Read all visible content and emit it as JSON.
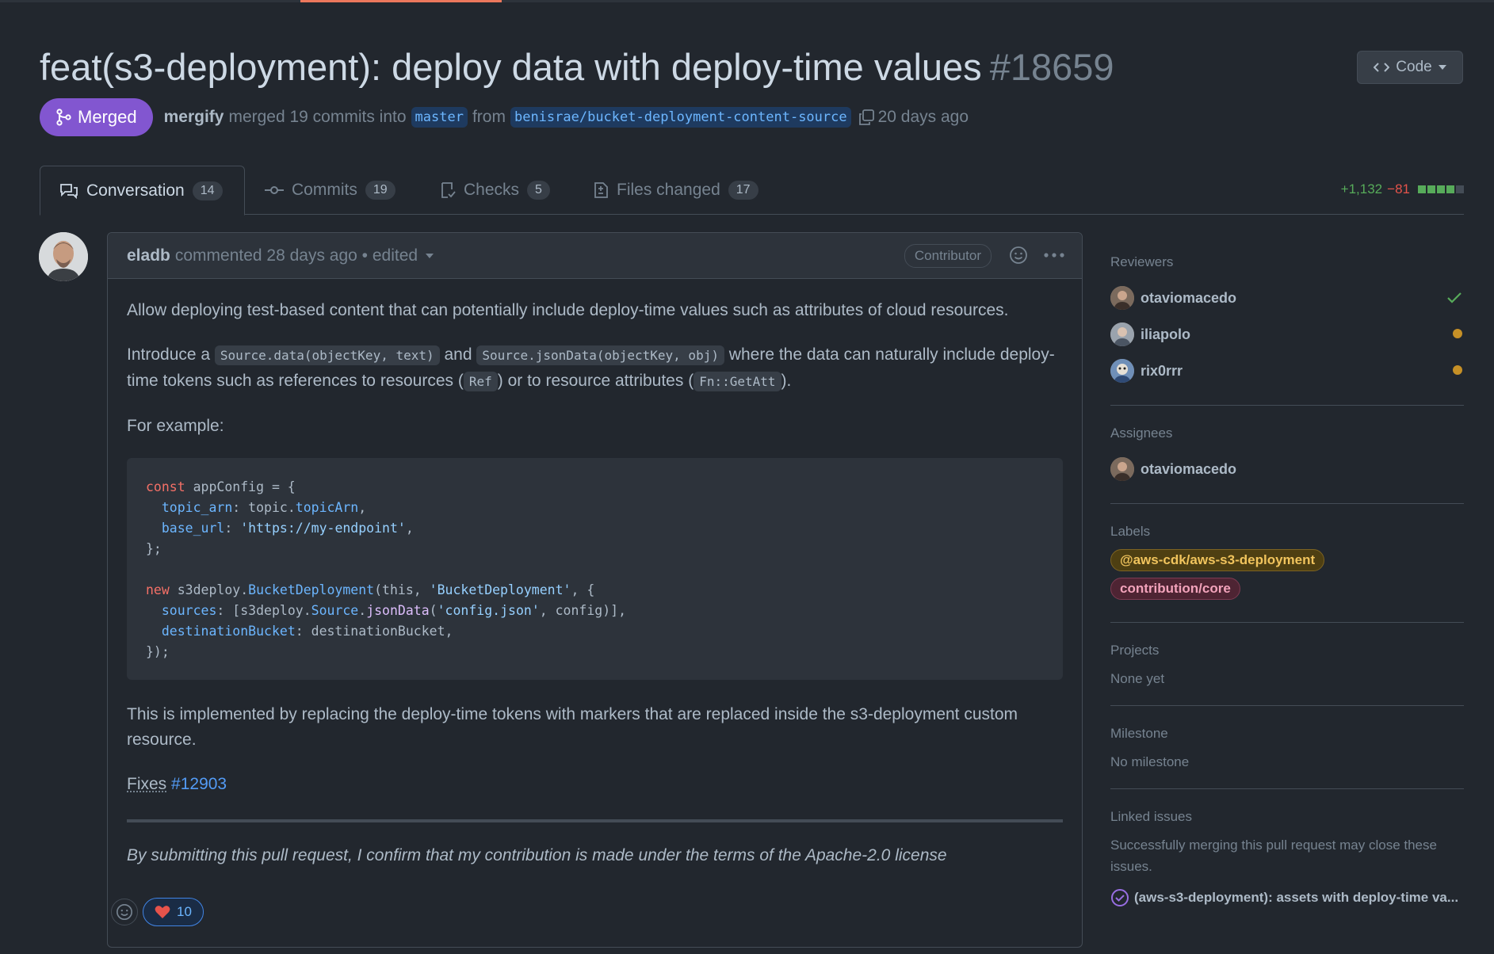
{
  "header": {
    "title": "feat(s3-deployment): deploy data with deploy-time values",
    "number": "#18659",
    "code_button": "Code"
  },
  "meta": {
    "status": "Merged",
    "author": "mergify",
    "action": "merged 19 commits into",
    "base_branch": "master",
    "from": "from",
    "head_branch": "benisrae/bucket-deployment-content-source",
    "time": "20 days ago"
  },
  "tabs": [
    {
      "label": "Conversation",
      "count": "14"
    },
    {
      "label": "Commits",
      "count": "19"
    },
    {
      "label": "Checks",
      "count": "5"
    },
    {
      "label": "Files changed",
      "count": "17"
    }
  ],
  "diffstat": {
    "additions": "+1,132",
    "deletions": "−81"
  },
  "comment": {
    "author": "eladb",
    "meta": "commented 28 days ago • edited",
    "role": "Contributor",
    "p1": "Allow deploying test-based content that can potentially include deploy-time values such as attributes of cloud resources.",
    "p2_a": "Introduce a ",
    "p2_code1": "Source.data(objectKey, text)",
    "p2_b": " and ",
    "p2_code2": "Source.jsonData(objectKey, obj)",
    "p2_c": " where the data can naturally include deploy-time tokens such as references to resources (",
    "p2_code3": "Ref",
    "p2_d": ") or to resource attributes (",
    "p2_code4": "Fn::GetAtt",
    "p2_e": ").",
    "p3": "For example:",
    "code": {
      "l1_kw": "const",
      "l1_rest": " appConfig = {",
      "l2_prop": "topic_arn",
      "l2_mid": ": topic.",
      "l2_val": "topicArn",
      "l2_end": ",",
      "l3_prop": "base_url",
      "l3_mid": ": ",
      "l3_str": "'https://my-endpoint'",
      "l3_end": ",",
      "l4": "};",
      "l6_kw": "new",
      "l6_a": " s3deploy.",
      "l6_cls": "BucketDeployment",
      "l6_b": "(this, ",
      "l6_str": "'BucketDeployment'",
      "l6_c": ", {",
      "l7_prop": "sources",
      "l7_a": ": [s3deploy.",
      "l7_cls": "Source",
      "l7_b": ".",
      "l7_fn": "jsonData",
      "l7_c": "(",
      "l7_str": "'config.json'",
      "l7_d": ", config)],",
      "l8_prop": "destinationBucket",
      "l8_rest": ": destinationBucket,",
      "l9": "});"
    },
    "p4": "This is implemented by replacing the deploy-time tokens with markers that are replaced inside the s3-deployment custom resource.",
    "fixes_label": "Fixes",
    "fixes_link": "#12903",
    "license": "By submitting this pull request, I confirm that my contribution is made under the terms of the Apache-2.0 license",
    "heart_count": "10"
  },
  "sidebar": {
    "reviewers_title": "Reviewers",
    "reviewers": [
      "otaviomacedo",
      "iliapolo",
      "rix0rrr"
    ],
    "assignees_title": "Assignees",
    "assignees": [
      "otaviomacedo"
    ],
    "labels_title": "Labels",
    "labels": [
      "@aws-cdk/aws-s3-deployment",
      "contribution/core"
    ],
    "projects_title": "Projects",
    "projects_value": "None yet",
    "milestone_title": "Milestone",
    "milestone_value": "No milestone",
    "linked_title": "Linked issues",
    "linked_desc": "Successfully merging this pull request may close these issues.",
    "linked_issue": "(aws-s3-deployment): assets with deploy-time va..."
  },
  "colors": {
    "background": "#22272e",
    "merged": "#8256d0",
    "link": "#539bf5",
    "pending": "#c69026",
    "approved": "#57ab5a"
  }
}
